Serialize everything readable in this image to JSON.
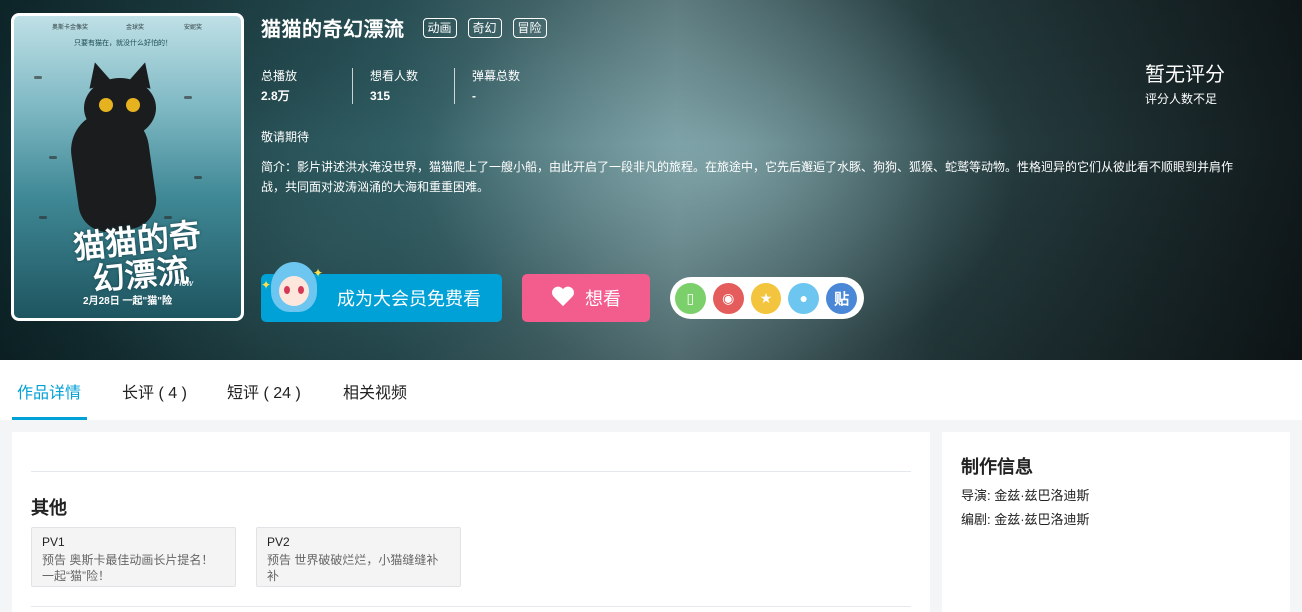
{
  "anime": {
    "title": "猫猫的奇幻漂流",
    "tags": [
      "动画",
      "奇幻",
      "冒险"
    ]
  },
  "poster": {
    "awards": [
      "奥斯卡金像奖",
      "金球奖",
      "安妮奖"
    ],
    "tagline": "只要有猫在，就没什么好怕的！",
    "title_art": "猫猫的奇幻漂流",
    "subtitle": "Flow",
    "date_line": "2月28日 一起\"猫\"险"
  },
  "stats": [
    {
      "label": "总播放",
      "value": "2.8万"
    },
    {
      "label": "想看人数",
      "value": "315"
    },
    {
      "label": "弹幕总数",
      "value": "-"
    }
  ],
  "release": "敬请期待",
  "summary": "简介：影片讲述洪水淹没世界，猫猫爬上了一艘小船，由此开启了一段非凡的旅程。在旅途中，它先后邂逅了水豚、狗狗、狐猴、蛇鹫等动物。性格迥异的它们从彼此看不顺眼到并肩作战，共同面对波涛汹涌的大海和重重困难。",
  "rating": {
    "text": "暂无评分",
    "sub": "评分人数不足"
  },
  "buttons": {
    "vip": "成为大会员免费看",
    "want": "想看"
  },
  "share": [
    {
      "icon": "mobile-icon",
      "glyph": "▯",
      "color": "#7bd06b"
    },
    {
      "icon": "weibo-icon",
      "glyph": "◉",
      "color": "#e55c5c"
    },
    {
      "icon": "qzone-icon",
      "glyph": "★",
      "color": "#f3c43d"
    },
    {
      "icon": "qq-icon",
      "glyph": "●",
      "color": "#6cc6ef"
    },
    {
      "icon": "tieba-icon",
      "glyph": "贴",
      "color": "#4a88d7"
    }
  ],
  "tabs": [
    "作品详情",
    "长评 ( 4 )",
    "短评 ( 24 )",
    "相关视频"
  ],
  "main": {
    "section_title": "其他",
    "pv": [
      {
        "name": "PV1",
        "desc": "预告 奥斯卡最佳动画长片提名！一起“猫”险！"
      },
      {
        "name": "PV2",
        "desc": "预告 世界破破烂烂，小猫缝缝补补"
      }
    ]
  },
  "production": {
    "title": "制作信息",
    "director": "导演: 金兹·兹巴洛迪斯",
    "writer": "编剧: 金兹·兹巴洛迪斯"
  }
}
